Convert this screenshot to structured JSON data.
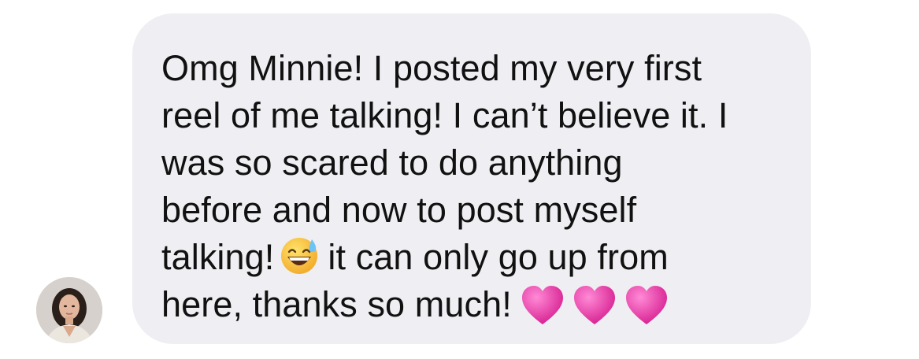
{
  "conversation": {
    "sender_avatar": "avatar-photo",
    "message": {
      "line1": "Omg Minnie! I posted my very first",
      "line2": "reel of me talking! I can’t believe it. I",
      "line3": "was so scared to do anything",
      "line4": "before and now to post myself",
      "line5_before": "talking!",
      "line5_after": "it can only go up from",
      "line6": "here, thanks so much!",
      "emoji_inline": "grinning-face-with-sweat-icon",
      "trailing_emoji": [
        "pink-heart-icon",
        "pink-heart-icon",
        "pink-heart-icon"
      ]
    },
    "colors": {
      "bubble_bg": "#efeff3",
      "text": "#111111",
      "heart": "#ec3ea8"
    }
  }
}
